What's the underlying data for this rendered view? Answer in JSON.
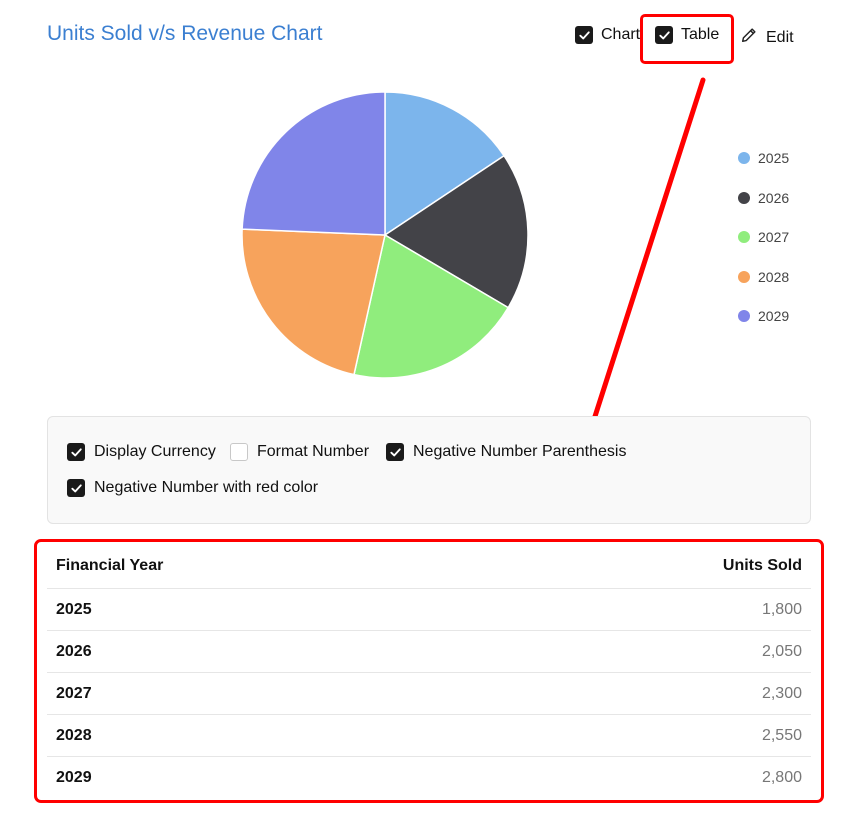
{
  "header": {
    "title": "Units Sold v/s Revenue Chart"
  },
  "toolbar": {
    "chart_label": "Chart",
    "chart_checked": true,
    "table_label": "Table",
    "table_checked": true,
    "edit_label": "Edit",
    "edit_icon": "pencil-icon"
  },
  "chart_data": {
    "type": "pie",
    "categories": [
      "2025",
      "2026",
      "2027",
      "2028",
      "2029"
    ],
    "values": [
      1800,
      2050,
      2300,
      2550,
      2800
    ],
    "colors": [
      "#7cb5ec",
      "#434348",
      "#90ed7d",
      "#f7a35c",
      "#8085e9"
    ],
    "legend_position": "right"
  },
  "options": {
    "display_currency": {
      "label": "Display Currency",
      "checked": true
    },
    "format_number": {
      "label": "Format Number",
      "checked": false
    },
    "negative_parenthesis": {
      "label": "Negative Number Parenthesis",
      "checked": true
    },
    "negative_red": {
      "label": "Negative Number with red color",
      "checked": true
    }
  },
  "table": {
    "columns": [
      "Financial Year",
      "Units Sold"
    ],
    "rows": [
      {
        "year": "2025",
        "units": "1,800"
      },
      {
        "year": "2026",
        "units": "2,050"
      },
      {
        "year": "2027",
        "units": "2,300"
      },
      {
        "year": "2028",
        "units": "2,550"
      },
      {
        "year": "2029",
        "units": "2,800"
      }
    ]
  },
  "annotations": {
    "highlight_color": "#ff0000"
  }
}
